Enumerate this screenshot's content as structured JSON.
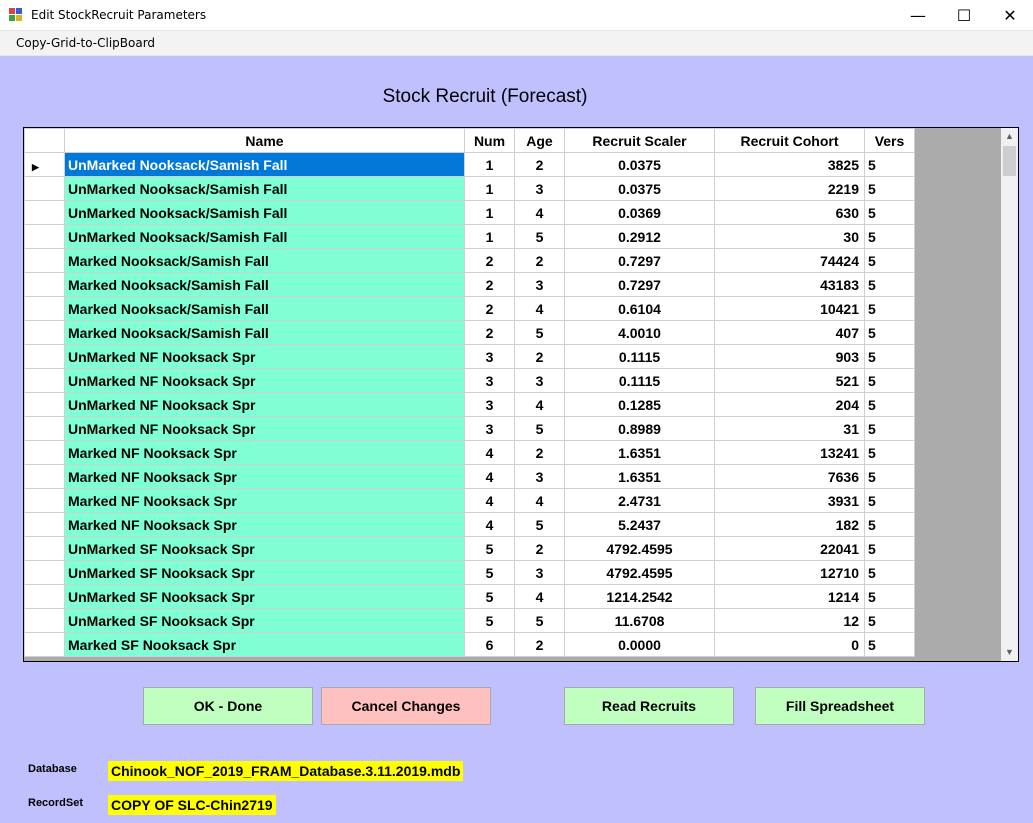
{
  "window": {
    "title": "Edit StockRecruit Parameters",
    "controls": {
      "minimize": "—",
      "maximize": "☐",
      "close": "✕"
    }
  },
  "menu": {
    "items": [
      "Copy-Grid-to-ClipBoard"
    ]
  },
  "page": {
    "title": "Stock Recruit (Forecast)"
  },
  "grid": {
    "columns": [
      "",
      "Name",
      "Num",
      "Age",
      "Recruit Scaler",
      "Recruit Cohort",
      "Vers"
    ],
    "row_indicator": "▶",
    "rows": [
      {
        "name": "UnMarked Nooksack/Samish Fall",
        "num": "1",
        "age": "2",
        "scaler": "0.0375",
        "cohort": "3825",
        "vers": "5"
      },
      {
        "name": "UnMarked Nooksack/Samish Fall",
        "num": "1",
        "age": "3",
        "scaler": "0.0375",
        "cohort": "2219",
        "vers": "5"
      },
      {
        "name": "UnMarked Nooksack/Samish Fall",
        "num": "1",
        "age": "4",
        "scaler": "0.0369",
        "cohort": "630",
        "vers": "5"
      },
      {
        "name": "UnMarked Nooksack/Samish Fall",
        "num": "1",
        "age": "5",
        "scaler": "0.2912",
        "cohort": "30",
        "vers": "5"
      },
      {
        "name": "Marked Nooksack/Samish Fall",
        "num": "2",
        "age": "2",
        "scaler": "0.7297",
        "cohort": "74424",
        "vers": "5"
      },
      {
        "name": "Marked Nooksack/Samish Fall",
        "num": "2",
        "age": "3",
        "scaler": "0.7297",
        "cohort": "43183",
        "vers": "5"
      },
      {
        "name": "Marked Nooksack/Samish Fall",
        "num": "2",
        "age": "4",
        "scaler": "0.6104",
        "cohort": "10421",
        "vers": "5"
      },
      {
        "name": "Marked Nooksack/Samish Fall",
        "num": "2",
        "age": "5",
        "scaler": "4.0010",
        "cohort": "407",
        "vers": "5"
      },
      {
        "name": "UnMarked NF Nooksack Spr",
        "num": "3",
        "age": "2",
        "scaler": "0.1115",
        "cohort": "903",
        "vers": "5"
      },
      {
        "name": "UnMarked NF Nooksack Spr",
        "num": "3",
        "age": "3",
        "scaler": "0.1115",
        "cohort": "521",
        "vers": "5"
      },
      {
        "name": "UnMarked NF Nooksack Spr",
        "num": "3",
        "age": "4",
        "scaler": "0.1285",
        "cohort": "204",
        "vers": "5"
      },
      {
        "name": "UnMarked NF Nooksack Spr",
        "num": "3",
        "age": "5",
        "scaler": "0.8989",
        "cohort": "31",
        "vers": "5"
      },
      {
        "name": "Marked NF Nooksack Spr",
        "num": "4",
        "age": "2",
        "scaler": "1.6351",
        "cohort": "13241",
        "vers": "5"
      },
      {
        "name": "Marked NF Nooksack Spr",
        "num": "4",
        "age": "3",
        "scaler": "1.6351",
        "cohort": "7636",
        "vers": "5"
      },
      {
        "name": "Marked NF Nooksack Spr",
        "num": "4",
        "age": "4",
        "scaler": "2.4731",
        "cohort": "3931",
        "vers": "5"
      },
      {
        "name": "Marked NF Nooksack Spr",
        "num": "4",
        "age": "5",
        "scaler": "5.2437",
        "cohort": "182",
        "vers": "5"
      },
      {
        "name": "UnMarked SF Nooksack Spr",
        "num": "5",
        "age": "2",
        "scaler": "4792.4595",
        "cohort": "22041",
        "vers": "5"
      },
      {
        "name": "UnMarked SF Nooksack Spr",
        "num": "5",
        "age": "3",
        "scaler": "4792.4595",
        "cohort": "12710",
        "vers": "5"
      },
      {
        "name": "UnMarked SF Nooksack Spr",
        "num": "5",
        "age": "4",
        "scaler": "1214.2542",
        "cohort": "1214",
        "vers": "5"
      },
      {
        "name": "UnMarked SF Nooksack Spr",
        "num": "5",
        "age": "5",
        "scaler": "11.6708",
        "cohort": "12",
        "vers": "5"
      },
      {
        "name": "Marked SF Nooksack Spr",
        "num": "6",
        "age": "2",
        "scaler": "0.0000",
        "cohort": "0",
        "vers": "5"
      }
    ]
  },
  "buttons": {
    "ok": "OK - Done",
    "cancel": "Cancel Changes",
    "read": "Read Recruits",
    "fill": "Fill Spreadsheet"
  },
  "info": {
    "database_label": "Database",
    "database_value": "Chinook_NOF_2019_FRAM_Database.3.11.2019.mdb",
    "recordset_label": "RecordSet",
    "recordset_value": "COPY OF SLC-Chin2719"
  },
  "colors": {
    "background": "#c0c0ff",
    "name_cell": "#80ffd4",
    "selected": "#0078d7",
    "ok_button": "#c0ffc0",
    "cancel_button": "#ffc0c0",
    "highlight": "#ffff00"
  }
}
